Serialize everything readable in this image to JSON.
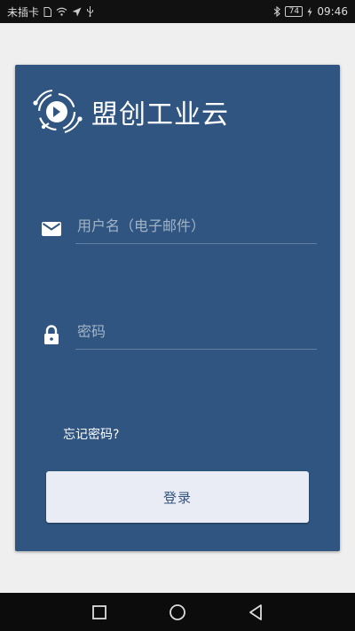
{
  "status_bar": {
    "carrier": "未插卡",
    "battery": "74",
    "time": "09:46"
  },
  "app": {
    "title": "盟创工业云"
  },
  "login": {
    "username_placeholder": "用户名（电子邮件）",
    "password_placeholder": "密码",
    "forgot_label": "忘记密码?",
    "submit_label": "登录"
  },
  "colors": {
    "card_background": "#2f5580",
    "button_background": "#e9ebf5",
    "page_background": "#efefef"
  }
}
